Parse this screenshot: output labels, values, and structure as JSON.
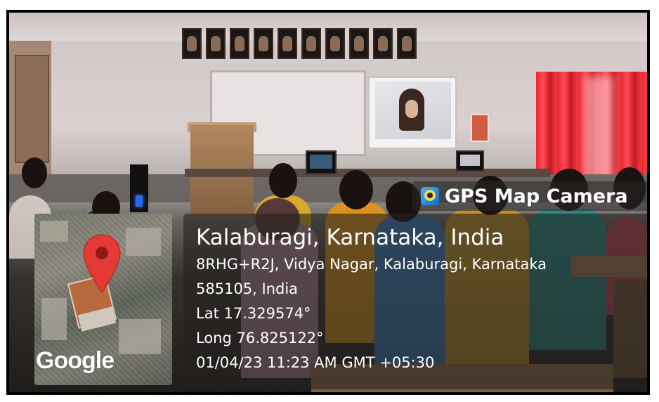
{
  "watermark": {
    "app_name": "GPS Map Camera",
    "map_provider": "Google",
    "icon": "gps-map-camera-app-icon"
  },
  "location": {
    "title": "Kalaburagi, Karnataka, India",
    "address_line1": "8RHG+R2J, Vidya Nagar, Kalaburagi, Karnataka",
    "address_line2": "585105, India",
    "latitude": "Lat 17.329574°",
    "longitude": "Long 76.825122°",
    "datetime": "01/04/23 11:23 AM GMT +05:30"
  },
  "colors": {
    "pin": "#e53935",
    "curtain": "#e8262f"
  }
}
